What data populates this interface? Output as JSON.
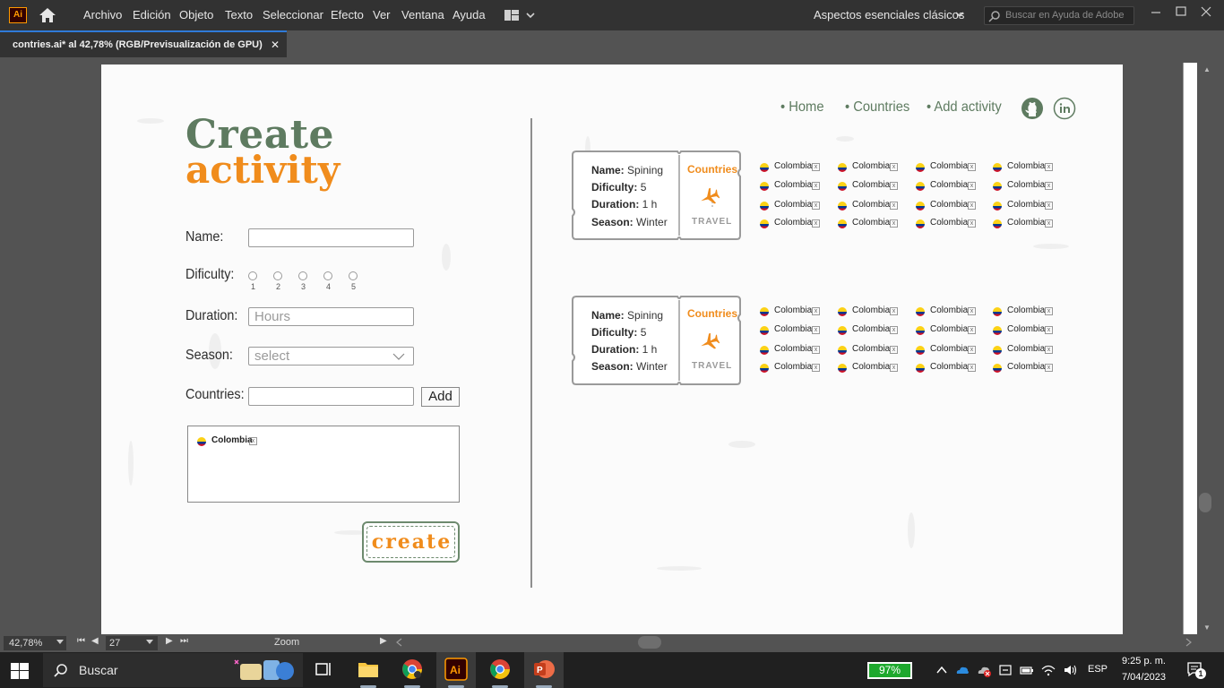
{
  "app": {
    "logo": "Ai",
    "menu": [
      "Archivo",
      "Edición",
      "Objeto",
      "Texto",
      "Seleccionar",
      "Efecto",
      "Ver",
      "Ventana",
      "Ayuda"
    ],
    "workspace": "Aspectos esenciales clásicos",
    "help_search_placeholder": "Buscar en Ayuda de Adobe"
  },
  "document": {
    "tab_title": "contries.ai* al 42,78% (RGB/Previsualización de GPU)",
    "close_glyph": "✕"
  },
  "status": {
    "zoom": "42,78%",
    "page": "27",
    "label": "Zoom"
  },
  "design": {
    "title_line1": "Create",
    "title_line2": "activity",
    "form": {
      "name_label": "Name:",
      "difficulty_label": "Dificulty:",
      "difficulty_options": [
        "1",
        "2",
        "3",
        "4",
        "5"
      ],
      "duration_label": "Duration:",
      "duration_placeholder": "Hours",
      "season_label": "Season:",
      "season_placeholder": "select",
      "countries_label": "Countries:",
      "add_button": "Add",
      "selected_country": "Colombia",
      "create_button": "create"
    },
    "nav": {
      "home": "• Home",
      "countries": "• Countries",
      "add_activity": "• Add activity"
    },
    "activities": [
      {
        "name_label": "Name:",
        "name": "Spining",
        "difficulty_label": "Dificulty:",
        "difficulty": "5",
        "duration_label": "Duration:",
        "duration": "1 h",
        "season_label": "Season:",
        "season": "Winter",
        "stub_title": "Countries",
        "stub_footer": "TRAVEL",
        "countries": [
          "Colombia",
          "Colombia",
          "Colombia",
          "Colombia",
          "Colombia",
          "Colombia",
          "Colombia",
          "Colombia",
          "Colombia",
          "Colombia",
          "Colombia",
          "Colombia",
          "Colombia",
          "Colombia",
          "Colombia",
          "Colombia"
        ]
      },
      {
        "name_label": "Name:",
        "name": "Spining",
        "difficulty_label": "Dificulty:",
        "difficulty": "5",
        "duration_label": "Duration:",
        "duration": "1 h",
        "season_label": "Season:",
        "season": "Winter",
        "stub_title": "Countries",
        "stub_footer": "TRAVEL",
        "countries": [
          "Colombia",
          "Colombia",
          "Colombia",
          "Colombia",
          "Colombia",
          "Colombia",
          "Colombia",
          "Colombia",
          "Colombia",
          "Colombia",
          "Colombia",
          "Colombia",
          "Colombia",
          "Colombia",
          "Colombia",
          "Colombia"
        ]
      }
    ],
    "colors": {
      "green": "#5e7b60",
      "orange": "#f08c1c"
    }
  },
  "taskbar": {
    "search_placeholder": "Buscar",
    "battery": "97%",
    "language": "ESP",
    "time": "9:25 p. m.",
    "date": "7/04/2023",
    "notifications": "1",
    "apps": [
      "widgets-icon",
      "task-view-icon",
      "file-explorer-icon",
      "chrome-icon",
      "illustrator-icon",
      "chrome-profile-icon",
      "powerpoint-icon"
    ]
  }
}
